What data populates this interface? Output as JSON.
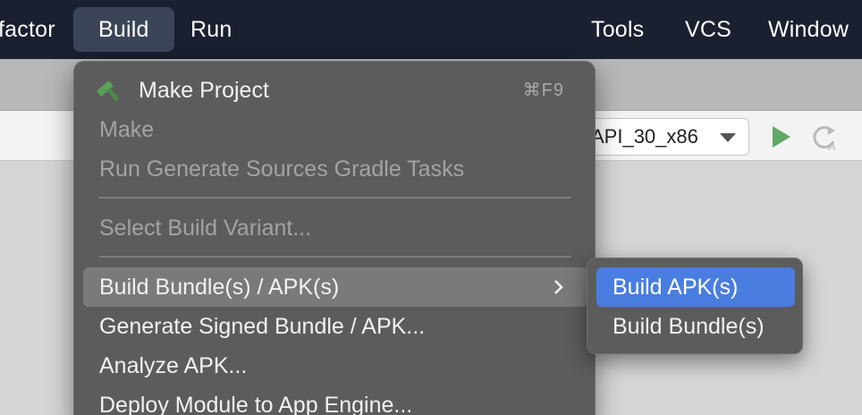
{
  "menubar": {
    "items": [
      {
        "label": "factor"
      },
      {
        "label": "Build"
      },
      {
        "label": "Run"
      },
      {
        "label": "Tools"
      },
      {
        "label": "VCS"
      },
      {
        "label": "Window"
      }
    ]
  },
  "toolbar": {
    "device_selector": "API_30_x86",
    "run_icon": "play-icon",
    "rerun_icon": "rerun-icon"
  },
  "build_menu": {
    "items": [
      {
        "label": "Make Project",
        "shortcut": "⌘F9",
        "icon": "hammer-icon",
        "enabled": true
      },
      {
        "label": "Make",
        "enabled": false
      },
      {
        "label": "Run Generate Sources Gradle Tasks",
        "enabled": false
      },
      {
        "label": "Select Build Variant...",
        "enabled": false
      },
      {
        "label": "Build Bundle(s) / APK(s)",
        "enabled": true,
        "submenu": true
      },
      {
        "label": "Generate Signed Bundle / APK...",
        "enabled": true
      },
      {
        "label": "Analyze APK...",
        "enabled": true
      },
      {
        "label": "Deploy Module to App Engine...",
        "enabled": true
      }
    ]
  },
  "submenu": {
    "items": [
      {
        "label": "Build APK(s)",
        "selected": true
      },
      {
        "label": "Build Bundle(s)",
        "selected": false
      }
    ]
  },
  "colors": {
    "menubar_bg": "#1a2030",
    "menu_bg": "#5c5c5c",
    "selection_blue": "#4a7de0",
    "run_green": "#5fa865",
    "hammer_green": "#5aa05a"
  }
}
